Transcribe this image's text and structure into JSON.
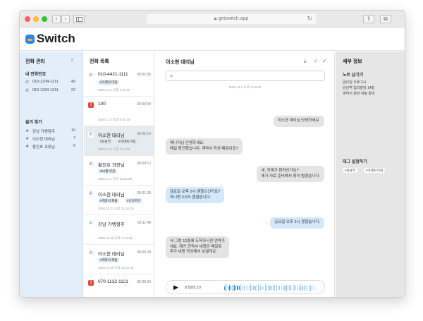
{
  "browser": {
    "url": "getswitch.app"
  },
  "app": {
    "name": "Switch"
  },
  "phone_panel": {
    "title": "전화 관리",
    "my_numbers_label": "내 전화번호",
    "numbers": [
      {
        "number": "010-1234-1211",
        "count": "48"
      },
      {
        "number": "010-1234-1211",
        "count": "22"
      }
    ],
    "favorites_label": "즐겨 찾기",
    "favorites": [
      {
        "name": "강남 가뱅점주",
        "count": "10"
      },
      {
        "name": "이소현 대리님",
        "count": "7"
      },
      {
        "name": "황진호 과장님",
        "count": "6"
      }
    ]
  },
  "call_list": {
    "title": "전화 목록",
    "items": [
      {
        "number": "010-4421-1111",
        "duration": "00:02:36",
        "tags": [
          "#거래처 미팅"
        ],
        "date": "2020.11.3 오후 1:21:11",
        "icon": "voice",
        "color": "#7b4bd6"
      },
      {
        "number": "100",
        "duration": "00:00:00",
        "tags": [],
        "date": "2020.11.3 오후 5:41:20",
        "icon": "missed",
        "color": "#e8453c"
      },
      {
        "number": "이소현 대리님",
        "duration": "00:05:10",
        "tags": [
          "#강남역",
          "#거래처 미팅"
        ],
        "date": "2020.11.3 오후 3:14:32",
        "icon": "voice",
        "color": "#2a86e8"
      },
      {
        "number": "황진호 과장님",
        "duration": "00:09:12",
        "tags": [
          "#12월 마감"
        ],
        "date": "2020.11.1 오전 10:22:28",
        "icon": "voice",
        "color": "#7b4bd6"
      },
      {
        "number": "이소현 대리님",
        "duration": "00:01:29",
        "tags": [
          "#계약서 재출",
          "#신규주문"
        ],
        "date": "2020.10.31 오후 11:41:20",
        "icon": "voice",
        "color": "#7b4bd6"
      },
      {
        "number": "강남 가뱅점주",
        "duration": "00:11:49",
        "tags": [],
        "date": "2020.10.30 오후 3:14:32",
        "icon": "voice",
        "color": "#2a86e8"
      },
      {
        "number": "이소현 대리님",
        "duration": "00:05:29",
        "tags": [
          "#계약서 재출"
        ],
        "date": "2020.10.29 오후 11:21:40",
        "icon": "voice",
        "color": "#7b4bd6"
      },
      {
        "number": "070-1132-1121",
        "duration": "00:00:00",
        "tags": [],
        "date": "",
        "icon": "missed",
        "color": "#e8453c"
      }
    ]
  },
  "conversation": {
    "title": "이소현 대리님",
    "search_placeholder": "",
    "timestamp": "2020.11.3 오후 3:14:32",
    "messages": [
      {
        "side": "right",
        "style": "gray",
        "lines": [
          "이소현 대리님 안녕하세요."
        ]
      },
      {
        "side": "left",
        "style": "gray",
        "lines": [
          "매니저님 안녕하세요.",
          "메일 확인했습니다. 계약서 작성 때문이죠?"
        ]
      },
      {
        "side": "right",
        "style": "gray",
        "lines": [
          "네, 언제가 편하신가요?",
          "제가 자료 준비해서 찾아 뵙겠습니다."
        ]
      },
      {
        "side": "left",
        "style": "blue",
        "lines": [
          "금요일 오후 2시 괜찮으신가요?",
          "아니면 3시도 괜찮습니다."
        ]
      },
      {
        "side": "right",
        "style": "blue",
        "lines": [
          "금요일 오후 2시 괜찮습니다."
        ]
      },
      {
        "side": "left",
        "style": "gray",
        "lines": [
          "네 그럼 12층에 도착하시면 연락주",
          "세요. 제가 견적서 내용은 메일로",
          "추가 내용 작성해서 보낼게요."
        ]
      }
    ],
    "player": {
      "time": "0:52/5:10",
      "progress": 0.17
    }
  },
  "detail": {
    "title": "세부 정보",
    "note_label": "노트 남기기",
    "note_lines": [
      "금요일 오후 2시",
      "강남역 힘리빌딩 14층",
      "계약서 관련 미팅 준비"
    ],
    "tag_label": "태그 설정하기",
    "tags": [
      "#강남역",
      "#거래처 미팅"
    ]
  },
  "colors": {
    "accent": "#2a86e8",
    "sidebar_bg": "#e3eefb",
    "detail_bg": "#e6e6e6"
  }
}
